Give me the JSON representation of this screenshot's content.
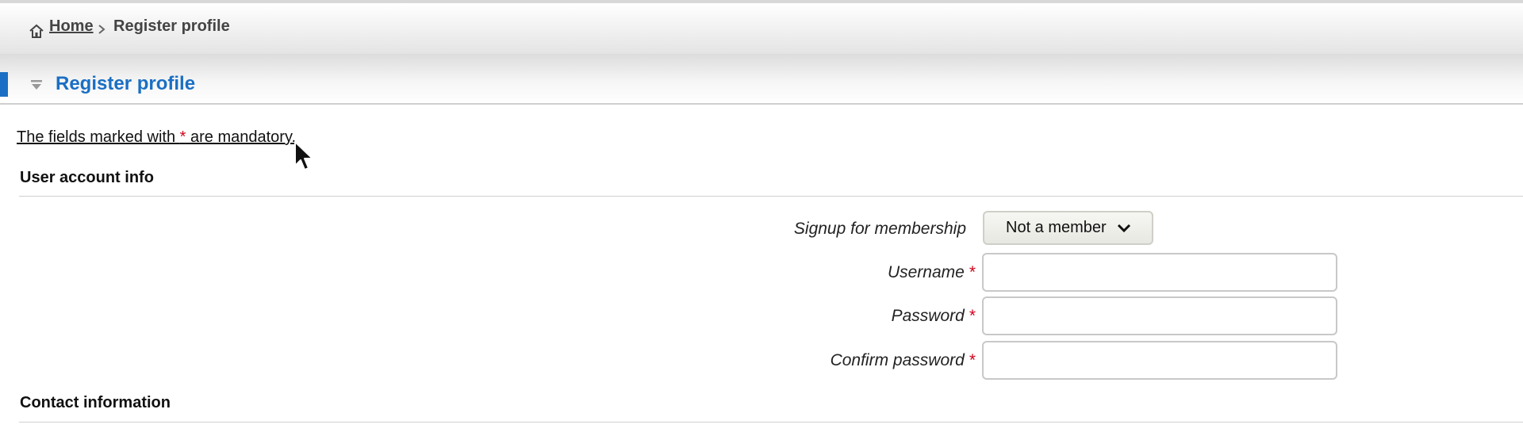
{
  "breadcrumb": {
    "home_label": "Home",
    "current_label": "Register profile"
  },
  "page": {
    "title": "Register profile",
    "mandatory_prefix": "The fields marked with ",
    "mandatory_star": "*",
    "mandatory_suffix": " are mandatory."
  },
  "sections": {
    "user_account": "User account info",
    "contact": "Contact information"
  },
  "form": {
    "membership_label": "Signup for membership",
    "membership_value": "Not a member",
    "username_label": "Username",
    "password_label": "Password",
    "confirm_password_label": "Confirm password",
    "required_mark": "*",
    "username_value": "",
    "password_value": "",
    "confirm_password_value": ""
  },
  "colors": {
    "accent": "#1a6fc4",
    "required": "#d0021b"
  },
  "icons": {
    "home": "home-icon",
    "separator": "chevron-right-icon",
    "toggle": "collapse-triangle-icon",
    "dropdown": "chevron-down-icon",
    "cursor": "mouse-pointer-icon"
  }
}
